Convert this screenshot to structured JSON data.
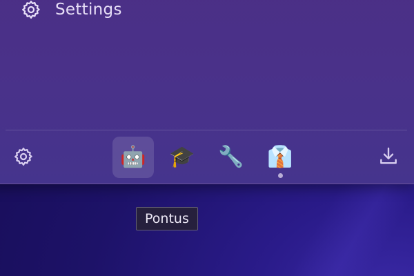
{
  "menu": {
    "settings_label": "Settings",
    "settings_icon": "gear-icon"
  },
  "toolbar": {
    "settings_icon": "gear-icon",
    "download_icon": "download-icon",
    "tabs": [
      {
        "emoji": "🤖",
        "icon": "robot-icon",
        "active": true,
        "indicator": false
      },
      {
        "emoji": "🎓",
        "icon": "graduation-cap-icon",
        "active": false,
        "indicator": false
      },
      {
        "emoji": "🔧",
        "icon": "wrench-icon",
        "active": false,
        "indicator": false
      },
      {
        "emoji": "👔",
        "icon": "shirt-tie-icon",
        "active": false,
        "indicator": true
      }
    ]
  },
  "tooltip": {
    "text": "Pontus"
  },
  "colors": {
    "panel": "#4a3189",
    "background": "#1d1268",
    "text": "#e7def7"
  }
}
